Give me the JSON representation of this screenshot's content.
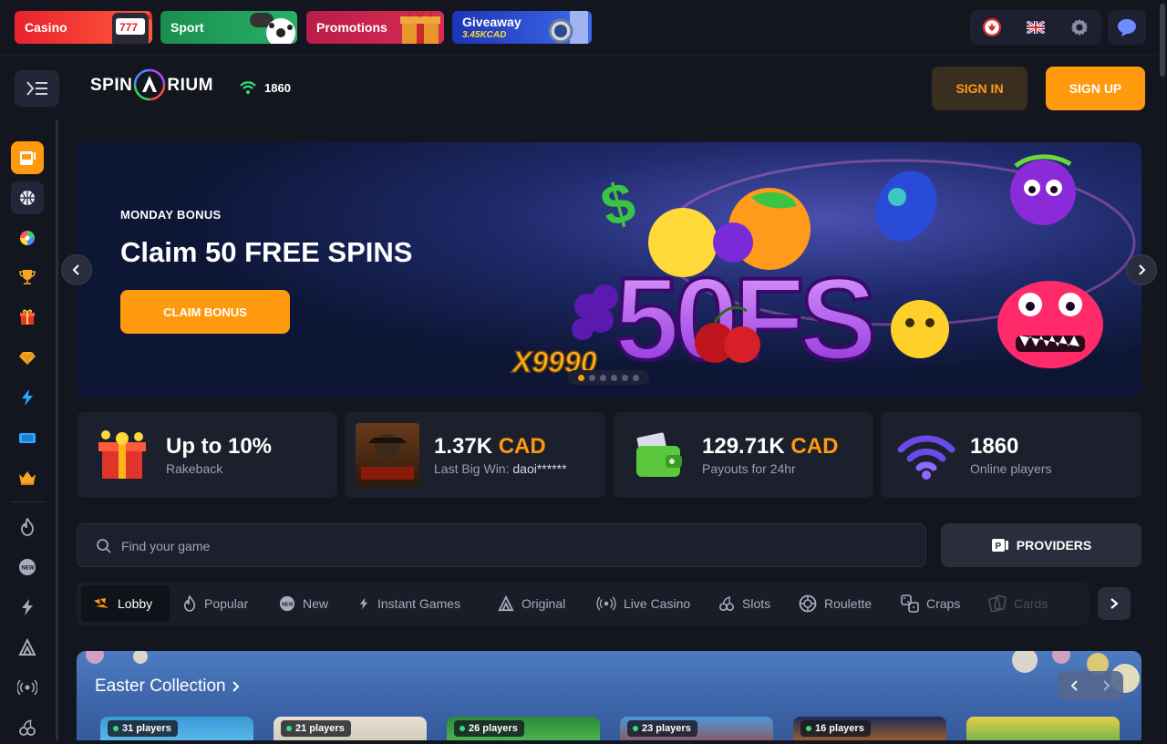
{
  "promo_tabs": [
    {
      "label": "Casino",
      "color": "#e8222f"
    },
    {
      "label": "Sport",
      "color": "#1f9a55"
    },
    {
      "label": "Promotions",
      "color": "#c21f4a"
    },
    {
      "label": "Giveaway",
      "sub": "3.45KCAD",
      "color": "#2744c8"
    }
  ],
  "header": {
    "logo_left": "SPIN",
    "logo_right": "RIUM",
    "online_count": "1860",
    "signin_label": "SIGN IN",
    "signup_label": "SIGN UP"
  },
  "banner": {
    "subtitle": "MONDAY BONUS",
    "title": "Claim 50 FREE SPINS",
    "button": "CLAIM BONUS",
    "art_text": "50FS",
    "art_multiplier": "X9990",
    "slides": 6,
    "active_slide": 1
  },
  "stats": [
    {
      "value": "Up to 10%",
      "currency": "",
      "label": "Rakeback"
    },
    {
      "value": "1.37K ",
      "currency": "CAD",
      "label": "Last Big Win:",
      "user": "daoi******"
    },
    {
      "value": "129.71K ",
      "currency": "CAD",
      "label": "Payouts for 24hr"
    },
    {
      "value": "1860",
      "currency": "",
      "label": "Online players"
    }
  ],
  "search": {
    "placeholder": "Find your game"
  },
  "providers_label": "PROVIDERS",
  "categories": [
    {
      "label": "Lobby",
      "icon": "lobby-icon",
      "active": true
    },
    {
      "label": "Popular",
      "icon": "fire-icon"
    },
    {
      "label": "New",
      "icon": "new-icon"
    },
    {
      "label": "Instant Games",
      "icon": "lightning-icon"
    },
    {
      "label": "Original",
      "icon": "original-icon"
    },
    {
      "label": "Live Casino",
      "icon": "live-icon"
    },
    {
      "label": "Slots",
      "icon": "cherry-icon"
    },
    {
      "label": "Roulette",
      "icon": "roulette-icon"
    },
    {
      "label": "Craps",
      "icon": "dice-icon"
    },
    {
      "label": "Cards",
      "icon": "cards-icon"
    }
  ],
  "collection": {
    "title": "Easter Collection",
    "tiles": [
      {
        "players": "31 players"
      },
      {
        "players": "21 players"
      },
      {
        "players": "26 players"
      },
      {
        "players": "23 players"
      },
      {
        "players": "16 players"
      },
      {
        "players": ""
      }
    ]
  },
  "colors": {
    "accent": "#ff9a0e",
    "bg": "#14161f",
    "panel": "#1c1f2c"
  }
}
